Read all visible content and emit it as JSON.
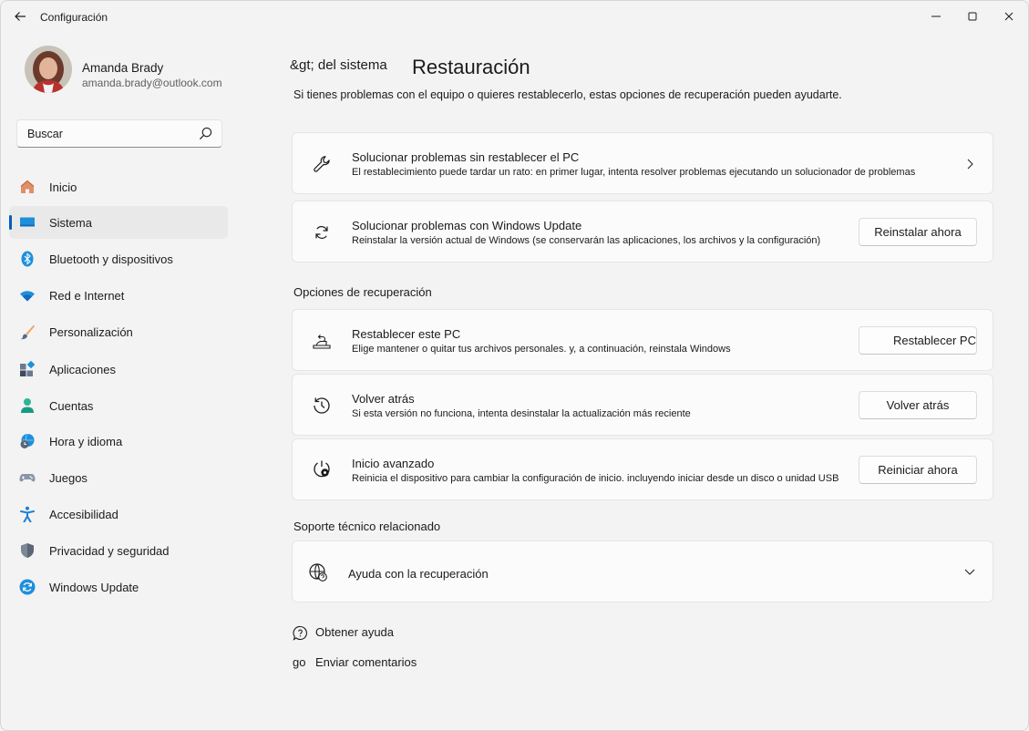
{
  "window": {
    "title": "Configuración"
  },
  "profile": {
    "name": "Amanda Brady",
    "email": "amanda.brady@outlook.com"
  },
  "search": {
    "placeholder": "Buscar"
  },
  "sidebar": {
    "items": [
      {
        "label": "Inicio",
        "icon": "home-icon"
      },
      {
        "label": "Sistema",
        "icon": "system-icon",
        "active": true
      },
      {
        "label": "Bluetooth y dispositivos",
        "icon": "bluetooth-icon"
      },
      {
        "label": "Red e Internet",
        "icon": "wifi-icon"
      },
      {
        "label": "Personalización",
        "icon": "brush-icon"
      },
      {
        "label": "Aplicaciones",
        "icon": "apps-icon"
      },
      {
        "label": "Cuentas",
        "icon": "accounts-icon"
      },
      {
        "label": "Hora y idioma",
        "icon": "time-language-icon"
      },
      {
        "label": "Juegos",
        "icon": "gamepad-icon"
      },
      {
        "label": "Accesibilidad",
        "icon": "accessibility-icon"
      },
      {
        "label": "Privacidad y seguridad",
        "icon": "shield-icon"
      },
      {
        "label": "Windows Update",
        "icon": "update-icon"
      }
    ]
  },
  "header": {
    "breadcrumb": "&gt; del sistema",
    "title": "Restauración",
    "subtitle": "Si tienes problemas con el equipo o quieres restablecerlo, estas opciones de recuperación pueden ayudarte."
  },
  "cards": {
    "troubleshoot": {
      "title": "Solucionar problemas sin restablecer el PC",
      "desc": "El restablecimiento puede tardar un rato: en primer lugar, intenta resolver problemas ejecutando un solucionador de problemas"
    },
    "windows_update": {
      "title": "Solucionar problemas con Windows Update",
      "desc": "Reinstalar la versión actual de Windows (se conservarán las aplicaciones, los archivos y la configuración)",
      "button": "Reinstalar ahora"
    }
  },
  "recovery": {
    "heading": "Opciones de recuperación",
    "items": [
      {
        "title": "Restablecer este PC",
        "desc": "Elige mantener o quitar tus archivos personales. y, a continuación, reinstala Windows",
        "button": "Restablecer PC"
      },
      {
        "title": "Volver atrás",
        "desc": "Si esta versión no funciona, intenta desinstalar la actualización más reciente",
        "button": "Volver atrás"
      },
      {
        "title": "Inicio avanzado",
        "desc": "Reinicia el dispositivo para cambiar la configuración de inicio. incluyendo iniciar desde un disco o unidad USB",
        "button": "Reiniciar ahora"
      }
    ]
  },
  "support": {
    "heading": "Soporte técnico relacionado",
    "help_title": "Ayuda con la recuperación"
  },
  "footer": {
    "get_help": "Obtener ayuda",
    "feedback_icon_text": "go",
    "feedback": "Enviar comentarios"
  },
  "colors": {
    "accent": "#005fb8",
    "background": "#f3f3f3",
    "card": "#fbfbfb"
  }
}
